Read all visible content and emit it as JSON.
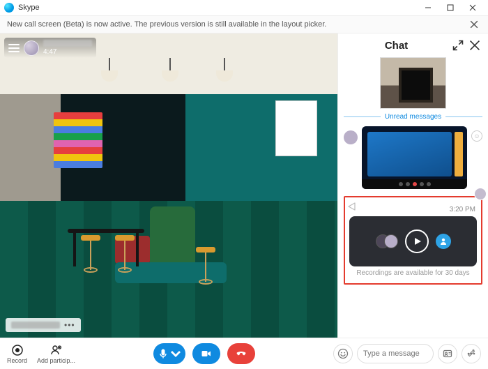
{
  "app": {
    "title": "Skype"
  },
  "banner": {
    "message": "New call screen (Beta) is now active. The previous version is still available in the layout picker."
  },
  "call": {
    "duration": "4:47"
  },
  "chat": {
    "title": "Chat",
    "unread_label": "Unread messages",
    "recording": {
      "timestamp": "3:20 PM",
      "note": "Recordings are available for 30 days"
    }
  },
  "composer": {
    "placeholder": "Type a message"
  },
  "bottom": {
    "record_label": "Record",
    "add_label": "Add particip..."
  },
  "icons": {
    "search": "search",
    "gear": "gear"
  }
}
